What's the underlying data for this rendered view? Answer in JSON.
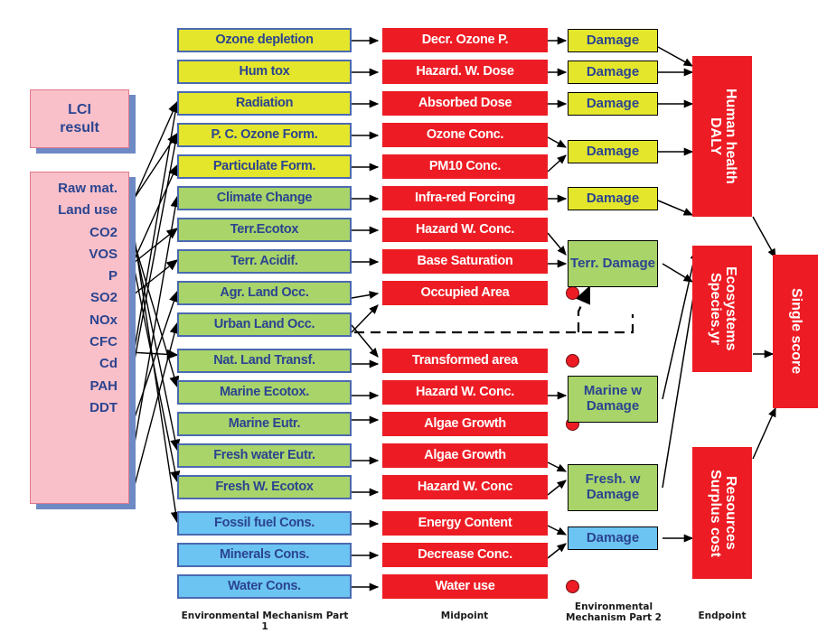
{
  "diagram": {
    "title": "ReCiPe LCIA framework: from LCI result through midpoint and endpoint to single score",
    "colors": {
      "yellow": "#e4e62b",
      "green": "#a9d46a",
      "blue": "#6cc4f2",
      "red": "#ed1c24",
      "pink": "#f9c0c9",
      "text_blue": "#2b4490",
      "border_blue": "#4a6ab0",
      "shadow_blue": "#6e8ac4"
    }
  },
  "lci": {
    "result_label_line1": "LCI",
    "result_label_line2": "result",
    "substances": [
      "Raw mat.",
      "Land use",
      "CO2",
      "VOS",
      "P",
      "SO2",
      "NOx",
      "CFC",
      "Cd",
      "PAH",
      "DDT"
    ]
  },
  "columns": {
    "mechanism_part1_caption": "Environmental Mechanism Part 1",
    "midpoint_caption": "Midpoint",
    "mechanism_part2_caption_line1": "Environmental",
    "mechanism_part2_caption_line2": "Mechanism Part 2",
    "endpoint_caption": "Endpoint"
  },
  "impact_categories": [
    {
      "label": "Ozone depletion",
      "color": "yellow"
    },
    {
      "label": "Hum tox",
      "color": "yellow"
    },
    {
      "label": "Radiation",
      "color": "yellow"
    },
    {
      "label": "P. C. Ozone Form.",
      "color": "yellow"
    },
    {
      "label": "Particulate Form.",
      "color": "yellow"
    },
    {
      "label": "Climate Change",
      "color": "green"
    },
    {
      "label": "Terr.Ecotox",
      "color": "green"
    },
    {
      "label": "Terr. Acidif.",
      "color": "green"
    },
    {
      "label": "Agr. Land Occ.",
      "color": "green"
    },
    {
      "label": "Urban Land Occ.",
      "color": "green"
    },
    {
      "label": "Nat. Land Transf.",
      "color": "green"
    },
    {
      "label": "Marine Ecotox.",
      "color": "green"
    },
    {
      "label": "Marine Eutr.",
      "color": "green"
    },
    {
      "label": "Fresh water Eutr.",
      "color": "green"
    },
    {
      "label": "Fresh W. Ecotox",
      "color": "green"
    },
    {
      "label": "Fossil fuel Cons.",
      "color": "blue"
    },
    {
      "label": "Minerals Cons.",
      "color": "blue"
    },
    {
      "label": "Water Cons.",
      "color": "blue"
    }
  ],
  "midpoints": [
    {
      "label": "Decr. Ozone P.",
      "dot": false
    },
    {
      "label": "Hazard. W. Dose",
      "dot": false
    },
    {
      "label": "Absorbed Dose",
      "dot": false
    },
    {
      "label": "Ozone Conc.",
      "dot": false
    },
    {
      "label": "PM10 Conc.",
      "dot": false
    },
    {
      "label": "Infra-red Forcing",
      "dot": false
    },
    {
      "label": "Hazard W. Conc.",
      "dot": false
    },
    {
      "label": "Base Saturation",
      "dot": false
    },
    {
      "label": "Occupied Area",
      "dot": true
    },
    {
      "label": "",
      "dot": false
    },
    {
      "label": "Transformed area",
      "dot": true
    },
    {
      "label": "Hazard W. Conc.",
      "dot": false
    },
    {
      "label": "Algae Growth",
      "dot": true
    },
    {
      "label": "Algae Growth",
      "dot": false
    },
    {
      "label": "Hazard W. Conc",
      "dot": false
    },
    {
      "label": "Energy Content",
      "dot": false
    },
    {
      "label": "Decrease Conc.",
      "dot": false
    },
    {
      "label": "Water use",
      "dot": true
    }
  ],
  "damages": [
    {
      "label": "Damage",
      "color": "yellow",
      "two_line": false
    },
    {
      "label": "Damage",
      "color": "yellow",
      "two_line": false
    },
    {
      "label": "Damage",
      "color": "yellow",
      "two_line": false
    },
    {
      "label": "Damage",
      "color": "yellow",
      "two_line": false
    },
    {
      "label": "Damage",
      "color": "yellow",
      "two_line": false
    },
    {
      "label": "Terr. Damage",
      "color": "green",
      "two_line": true
    },
    {
      "label": "Marine w Damage",
      "color": "green",
      "two_line": true
    },
    {
      "label": "Fresh. w Damage",
      "color": "green",
      "two_line": true
    },
    {
      "label": "Damage",
      "color": "blue",
      "two_line": false
    }
  ],
  "endpoints": [
    {
      "label": "Human health\nDALY"
    },
    {
      "label": "Ecosystems\nSpecies.yr"
    },
    {
      "label": "Resources\nSurplus cost"
    }
  ],
  "single_score": {
    "label": "Single score"
  }
}
